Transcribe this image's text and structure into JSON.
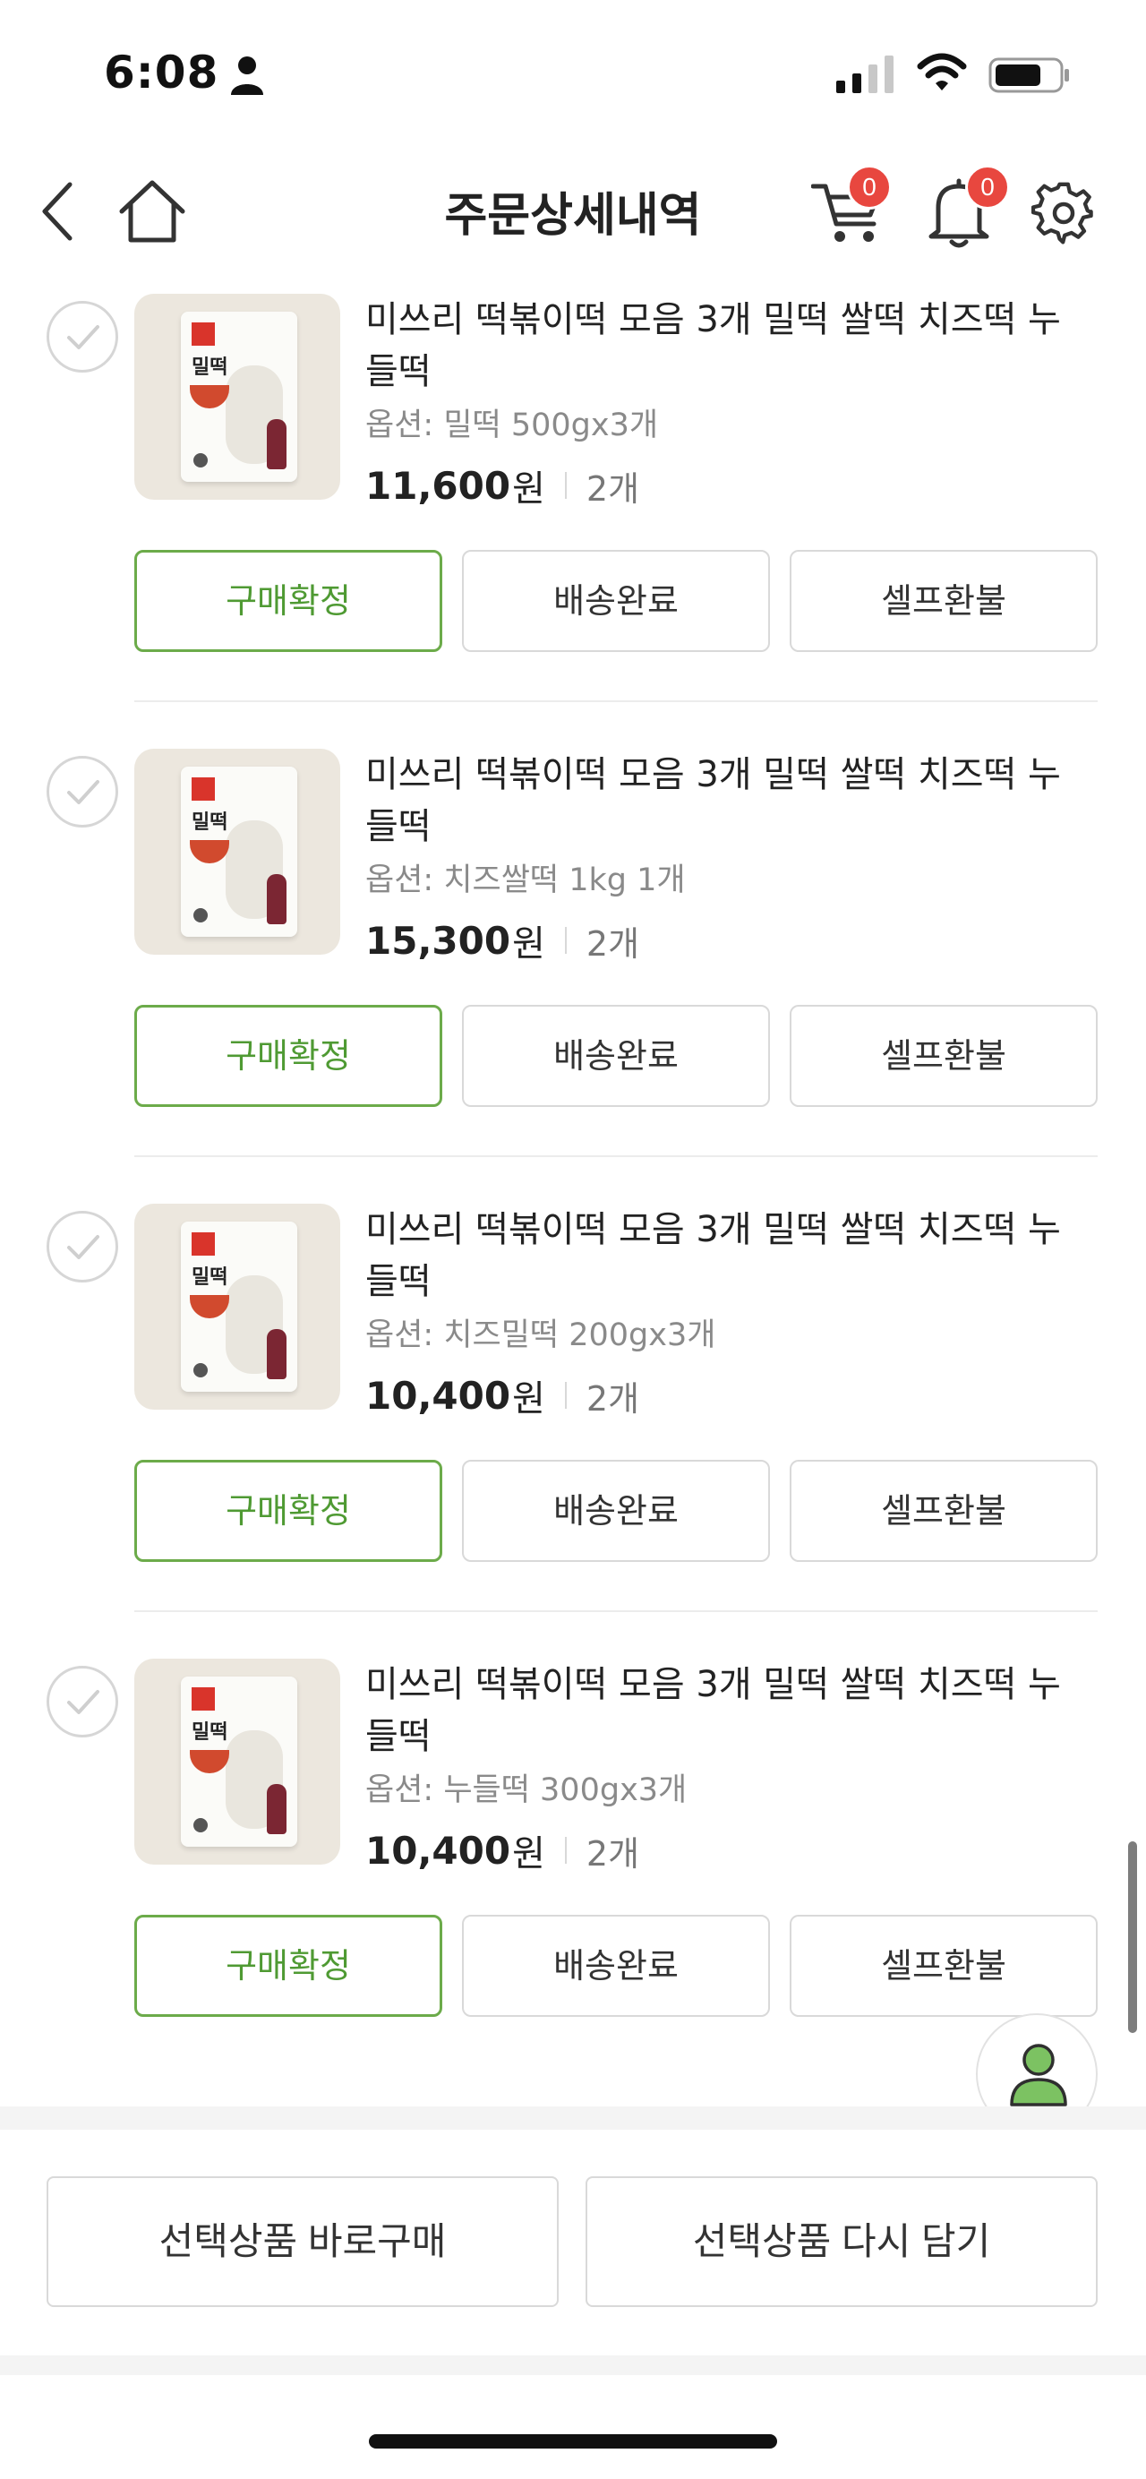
{
  "status_bar": {
    "time": "6:08"
  },
  "header": {
    "title": "주문상세내역",
    "cart_count": "0",
    "notification_count": "0"
  },
  "items": [
    {
      "name": "미쓰리 떡볶이떡 모음 3개 밀떡 쌀떡 치즈떡 누들떡",
      "option": "옵션: 밀떡 500gx3개",
      "price": "11,600",
      "currency": "원",
      "qty": "2개",
      "btn_confirm": "구매확정",
      "btn_delivered": "배송완료",
      "btn_refund": "셀프환불"
    },
    {
      "name": "미쓰리 떡볶이떡 모음 3개 밀떡 쌀떡 치즈떡 누들떡",
      "option": "옵션: 치즈쌀떡 1kg 1개",
      "price": "15,300",
      "currency": "원",
      "qty": "2개",
      "btn_confirm": "구매확정",
      "btn_delivered": "배송완료",
      "btn_refund": "셀프환불"
    },
    {
      "name": "미쓰리 떡볶이떡 모음 3개 밀떡 쌀떡 치즈떡 누들떡",
      "option": "옵션: 치즈밀떡 200gx3개",
      "price": "10,400",
      "currency": "원",
      "qty": "2개",
      "btn_confirm": "구매확정",
      "btn_delivered": "배송완료",
      "btn_refund": "셀프환불"
    },
    {
      "name": "미쓰리 떡볶이떡 모음 3개 밀떡 쌀떡 치즈떡 누들떡",
      "option": "옵션: 누들떡 300gx3개",
      "price": "10,400",
      "currency": "원",
      "qty": "2개",
      "btn_confirm": "구매확정",
      "btn_delivered": "배송완료",
      "btn_refund": "셀프환불"
    }
  ],
  "product_image": {
    "package_label": "밀떡"
  },
  "bottom_actions": {
    "buy_now": "선택상품 바로구매",
    "add_to_cart_again": "선택상품 다시 담기"
  },
  "colors": {
    "accent_green": "#4f9a33",
    "badge_red": "#e8473f"
  },
  "icons": [
    "back-icon",
    "home-icon",
    "cart-icon",
    "bell-icon",
    "gear-icon",
    "check-icon",
    "profile-icon"
  ]
}
